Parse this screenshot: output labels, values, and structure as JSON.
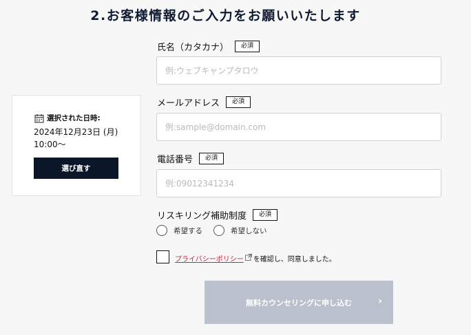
{
  "section": {
    "title": "2.お客様情報のご入力をお願いいたします"
  },
  "slot": {
    "label": "選択された日時:",
    "date": "2024年12月23日 (月)",
    "time": "10:00〜",
    "reselect_label": "選び直す"
  },
  "fields": {
    "required_badge": "必須",
    "kana": {
      "label": "氏名（カタカナ）",
      "placeholder": "例:ウェブキャンプタロウ"
    },
    "email": {
      "label": "メールアドレス",
      "placeholder": "例:sample@domain.com"
    },
    "phone": {
      "label": "電話番号",
      "placeholder": "例:09012341234"
    },
    "reskilling": {
      "label": "リスキリング補助制度",
      "options": [
        "希望する",
        "希望しない"
      ]
    }
  },
  "consent": {
    "link_text": "プライバシーポリシー",
    "suffix": "を確認し、同意しました。"
  },
  "submit": {
    "label": "無料カウンセリングに申し込む",
    "chevron": "›"
  },
  "colors": {
    "primary_dark": "#0b1628",
    "link_red": "#d1203a",
    "submit_disabled": "#bbc1cc"
  }
}
